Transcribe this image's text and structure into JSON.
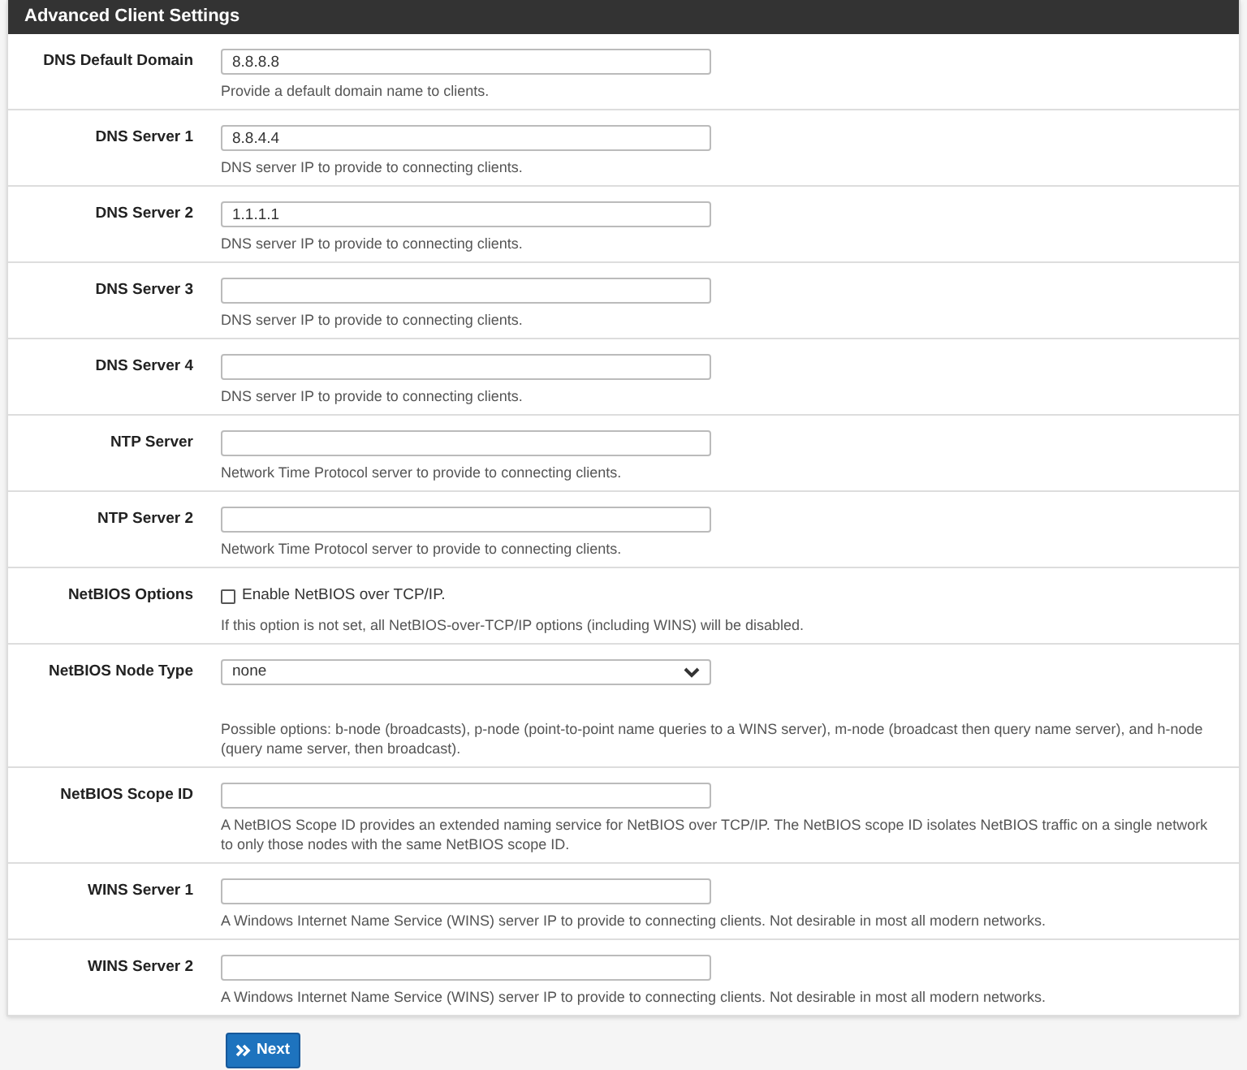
{
  "panel": {
    "title": "Advanced Client Settings"
  },
  "rows": [
    {
      "kind": "text",
      "label": "DNS Default Domain",
      "value": "8.8.8.8",
      "help": "Provide a default domain name to clients."
    },
    {
      "kind": "text",
      "label": "DNS Server 1",
      "value": "8.8.4.4",
      "help": "DNS server IP to provide to connecting clients."
    },
    {
      "kind": "text",
      "label": "DNS Server 2",
      "value": "1.1.1.1",
      "help": "DNS server IP to provide to connecting clients."
    },
    {
      "kind": "text",
      "label": "DNS Server 3",
      "help": "DNS server IP to provide to connecting clients."
    },
    {
      "kind": "text",
      "label": "DNS Server 4",
      "help": "DNS server IP to provide to connecting clients."
    },
    {
      "kind": "text",
      "label": "NTP Server",
      "help": "Network Time Protocol server to provide to connecting clients."
    },
    {
      "kind": "text",
      "label": "NTP Server 2",
      "help": "Network Time Protocol server to provide to connecting clients."
    },
    {
      "kind": "checkbox",
      "label": "NetBIOS Options",
      "option": "Enable NetBIOS over TCP/IP.",
      "checked": false,
      "help": "If this option is not set, all NetBIOS-over-TCP/IP options (including WINS) will be disabled."
    },
    {
      "kind": "select",
      "label": "NetBIOS Node Type",
      "value": "none",
      "help": "Possible options: b-node (broadcasts), p-node (point-to-point name queries to a WINS server), m-node (broadcast then query name server), and h-node (query name server, then broadcast)."
    },
    {
      "kind": "text",
      "label": "NetBIOS Scope ID",
      "help": "A NetBIOS Scope ID provides an extended naming service for NetBIOS over TCP/IP. The NetBIOS scope ID isolates NetBIOS traffic on a single network to only those nodes with the same NetBIOS scope ID."
    },
    {
      "kind": "text",
      "label": "WINS Server 1",
      "help": "A Windows Internet Name Service (WINS) server IP to provide to connecting clients. Not desirable in most all modern networks."
    },
    {
      "kind": "text",
      "label": "WINS Server 2",
      "help": "A Windows Internet Name Service (WINS) server IP to provide to connecting clients. Not desirable in most all modern networks."
    }
  ],
  "next_button": {
    "label": "Next"
  }
}
